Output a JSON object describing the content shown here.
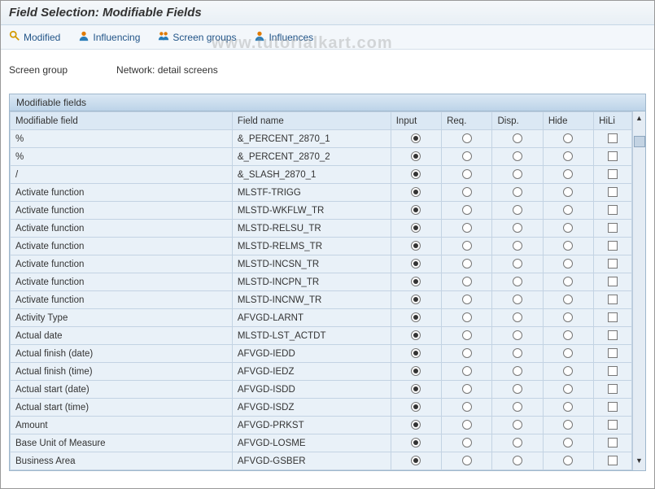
{
  "title": "Field Selection: Modifiable Fields",
  "toolbar": {
    "modified": "Modified",
    "influencing": "Influencing",
    "screen_groups": "Screen groups",
    "influences": "Influences"
  },
  "info": {
    "label": "Screen group",
    "value": "Network: detail screens"
  },
  "panel_title": "Modifiable fields",
  "columns": {
    "modifiable_field": "Modifiable field",
    "field_name": "Field name",
    "input": "Input",
    "req": "Req.",
    "disp": "Disp.",
    "hide": "Hide",
    "hili": "HiLi"
  },
  "rows": [
    {
      "mf": "%",
      "fn": "&_PERCENT_2870_1",
      "sel": "input"
    },
    {
      "mf": "%",
      "fn": "&_PERCENT_2870_2",
      "sel": "input"
    },
    {
      "mf": "/",
      "fn": "&_SLASH_2870_1",
      "sel": "input"
    },
    {
      "mf": "Activate function",
      "fn": "MLSTF-TRIGG",
      "sel": "input"
    },
    {
      "mf": "Activate function",
      "fn": "MLSTD-WKFLW_TR",
      "sel": "input"
    },
    {
      "mf": "Activate function",
      "fn": "MLSTD-RELSU_TR",
      "sel": "input"
    },
    {
      "mf": "Activate function",
      "fn": "MLSTD-RELMS_TR",
      "sel": "input"
    },
    {
      "mf": "Activate function",
      "fn": "MLSTD-INCSN_TR",
      "sel": "input"
    },
    {
      "mf": "Activate function",
      "fn": "MLSTD-INCPN_TR",
      "sel": "input"
    },
    {
      "mf": "Activate function",
      "fn": "MLSTD-INCNW_TR",
      "sel": "input"
    },
    {
      "mf": "Activity Type",
      "fn": "AFVGD-LARNT",
      "sel": "input"
    },
    {
      "mf": "Actual date",
      "fn": "MLSTD-LST_ACTDT",
      "sel": "input"
    },
    {
      "mf": "Actual finish (date)",
      "fn": "AFVGD-IEDD",
      "sel": "input"
    },
    {
      "mf": "Actual finish (time)",
      "fn": "AFVGD-IEDZ",
      "sel": "input"
    },
    {
      "mf": "Actual start (date)",
      "fn": "AFVGD-ISDD",
      "sel": "input"
    },
    {
      "mf": "Actual start (time)",
      "fn": "AFVGD-ISDZ",
      "sel": "input"
    },
    {
      "mf": "Amount",
      "fn": "AFVGD-PRKST",
      "sel": "input"
    },
    {
      "mf": "Base Unit of Measure",
      "fn": "AFVGD-LOSME",
      "sel": "input"
    },
    {
      "mf": "Business Area",
      "fn": "AFVGD-GSBER",
      "sel": "input"
    }
  ],
  "watermark": "www.tutorialkart.com"
}
